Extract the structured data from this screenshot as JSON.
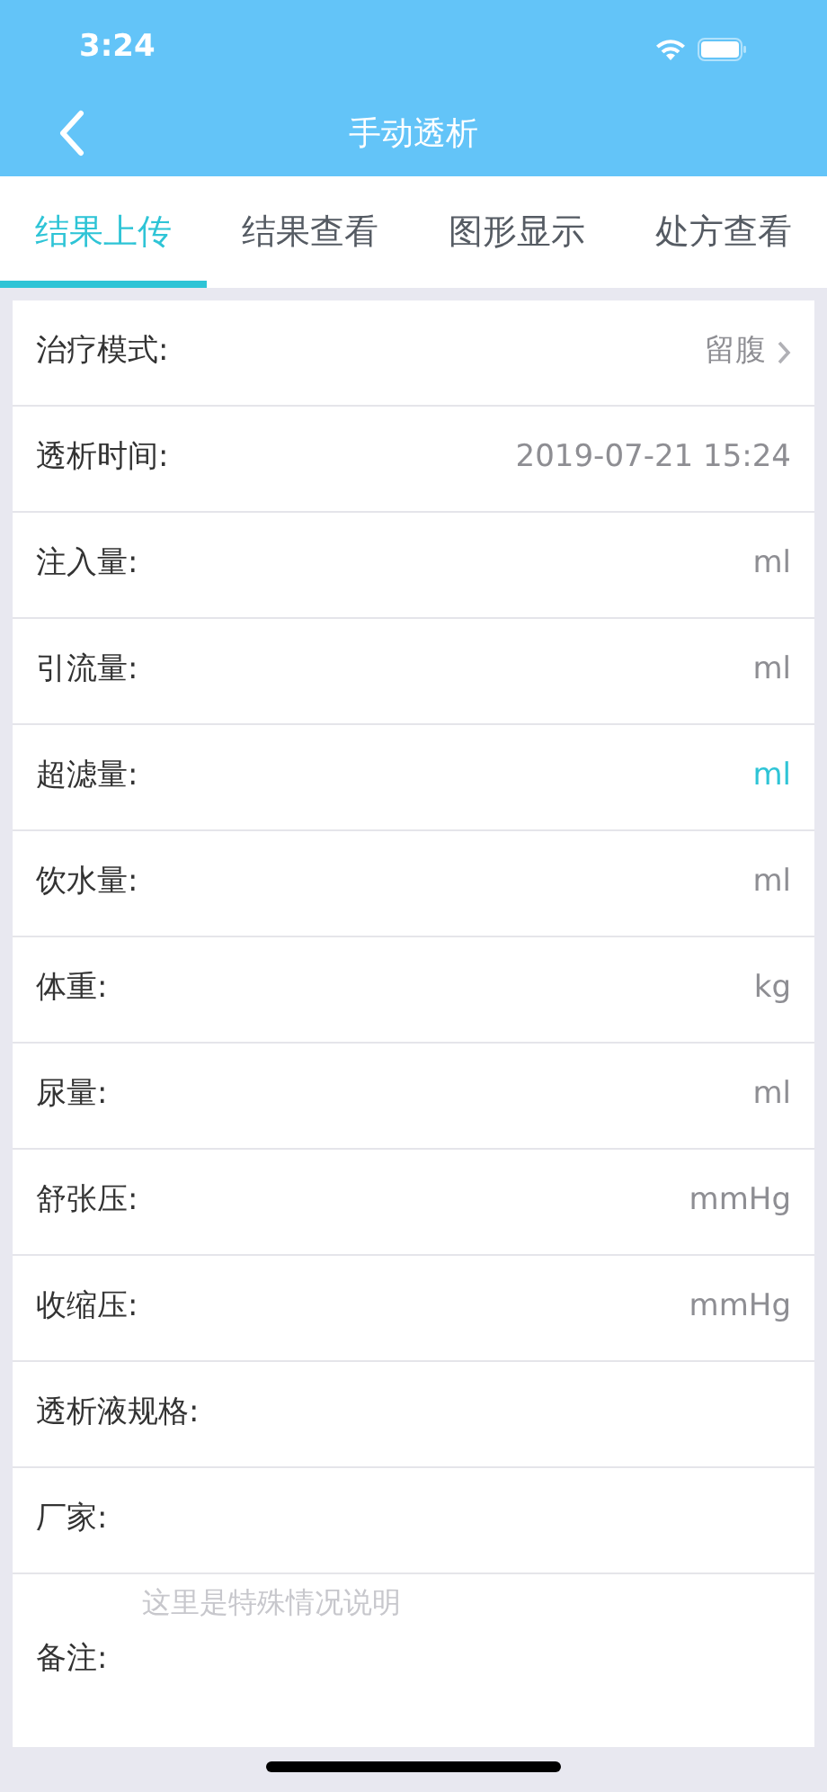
{
  "status_bar": {
    "time": "3:24"
  },
  "nav": {
    "title": "手动透析"
  },
  "tabs": [
    {
      "label": "结果上传",
      "selected": true
    },
    {
      "label": "结果查看",
      "selected": false
    },
    {
      "label": "图形显示",
      "selected": false
    },
    {
      "label": "处方查看",
      "selected": false
    }
  ],
  "rows": [
    {
      "kind": "select",
      "label": "治疗模式:",
      "value": "留腹"
    },
    {
      "kind": "value",
      "label": "透析时间:",
      "value": "2019-07-21 15:24"
    },
    {
      "kind": "unit",
      "label": "注入量:",
      "value": "ml",
      "highlighted": false
    },
    {
      "kind": "unit",
      "label": "引流量:",
      "value": "ml",
      "highlighted": false
    },
    {
      "kind": "unit",
      "label": "超滤量:",
      "value": "ml",
      "highlighted": true
    },
    {
      "kind": "unit",
      "label": "饮水量:",
      "value": "ml",
      "highlighted": false
    },
    {
      "kind": "unit",
      "label": "体重:",
      "value": "kg",
      "highlighted": false
    },
    {
      "kind": "unit",
      "label": "尿量:",
      "value": "ml",
      "highlighted": false
    },
    {
      "kind": "unit",
      "label": "舒张压:",
      "value": "mmHg",
      "highlighted": false
    },
    {
      "kind": "unit",
      "label": "收缩压:",
      "value": "mmHg",
      "highlighted": false
    },
    {
      "kind": "empty",
      "label": "透析液规格:"
    },
    {
      "kind": "empty",
      "label": "厂家:"
    },
    {
      "kind": "note",
      "label": "备注:",
      "placeholder": "这里是特殊情况说明"
    }
  ]
}
